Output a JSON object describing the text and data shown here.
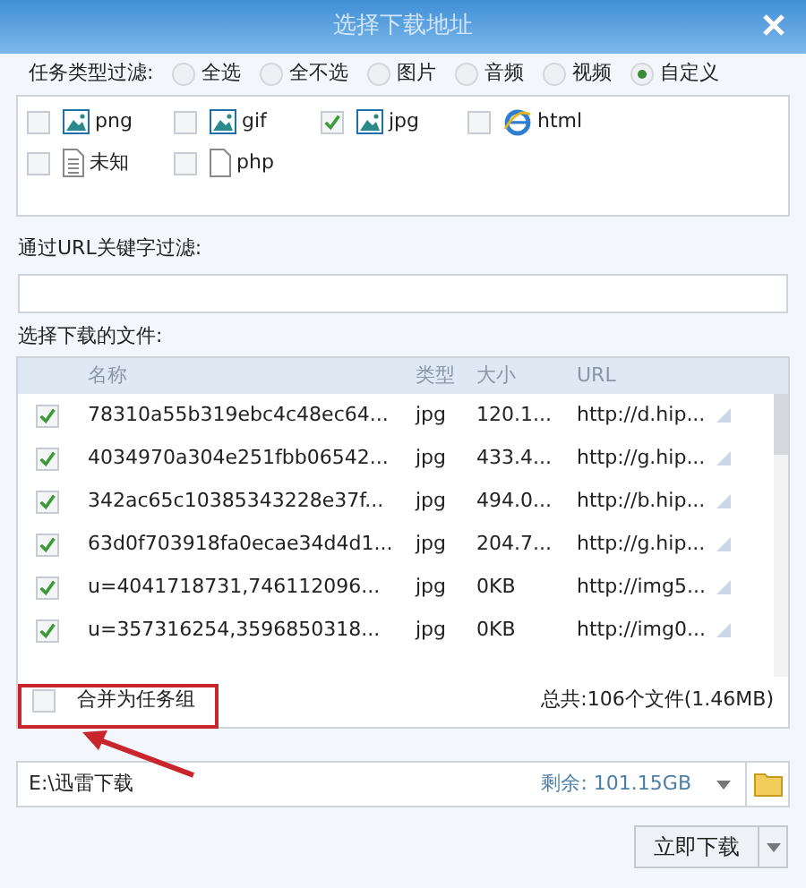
{
  "window": {
    "title": "选择下载地址"
  },
  "type_filter": {
    "label": "任务类型过滤:",
    "options": [
      {
        "label": "全选",
        "selected": false
      },
      {
        "label": "全不选",
        "selected": false
      },
      {
        "label": "图片",
        "selected": false
      },
      {
        "label": "音频",
        "selected": false
      },
      {
        "label": "视频",
        "selected": false
      },
      {
        "label": "自定义",
        "selected": true
      }
    ]
  },
  "extensions": [
    {
      "label": "png",
      "kind": "image",
      "checked": false
    },
    {
      "label": "gif",
      "kind": "image",
      "checked": false
    },
    {
      "label": "jpg",
      "kind": "image",
      "checked": true
    },
    {
      "label": "html",
      "kind": "web",
      "checked": false
    },
    {
      "label": "未知",
      "kind": "text",
      "checked": false
    },
    {
      "label": "php",
      "kind": "blank",
      "checked": false
    }
  ],
  "url_filter": {
    "label": "通过URL关键字过滤:"
  },
  "files": {
    "label": "选择下载的文件:",
    "columns": [
      "名称",
      "类型",
      "大小",
      "URL"
    ],
    "rows": [
      {
        "checked": true,
        "name": "78310a55b319ebc4c48ec64...",
        "type": "jpg",
        "size": "120.1...",
        "url": "http://d.hip..."
      },
      {
        "checked": true,
        "name": "4034970a304e251fbb06542...",
        "type": "jpg",
        "size": "433.4...",
        "url": "http://g.hip..."
      },
      {
        "checked": true,
        "name": "342ac65c10385343228e37f...",
        "type": "jpg",
        "size": "494.0...",
        "url": "http://b.hip..."
      },
      {
        "checked": true,
        "name": "63d0f703918fa0ecae34d4d1...",
        "type": "jpg",
        "size": "204.7...",
        "url": "http://g.hip..."
      },
      {
        "checked": true,
        "name": "u=4041718731,746112096...",
        "type": "jpg",
        "size": "0KB",
        "url": "http://img5..."
      },
      {
        "checked": true,
        "name": "u=357316254,3596850318...",
        "type": "jpg",
        "size": "0KB",
        "url": "http://img0..."
      }
    ],
    "merge": {
      "label": "合并为任务组",
      "checked": false
    },
    "total": "总共:106个文件(1.46MB)"
  },
  "save_path": {
    "value": "E:\\迅雷下载",
    "free_space": "剩余: 101.15GB"
  },
  "download_button": "立即下载",
  "annotation": {
    "kind": "box-and-arrow"
  }
}
